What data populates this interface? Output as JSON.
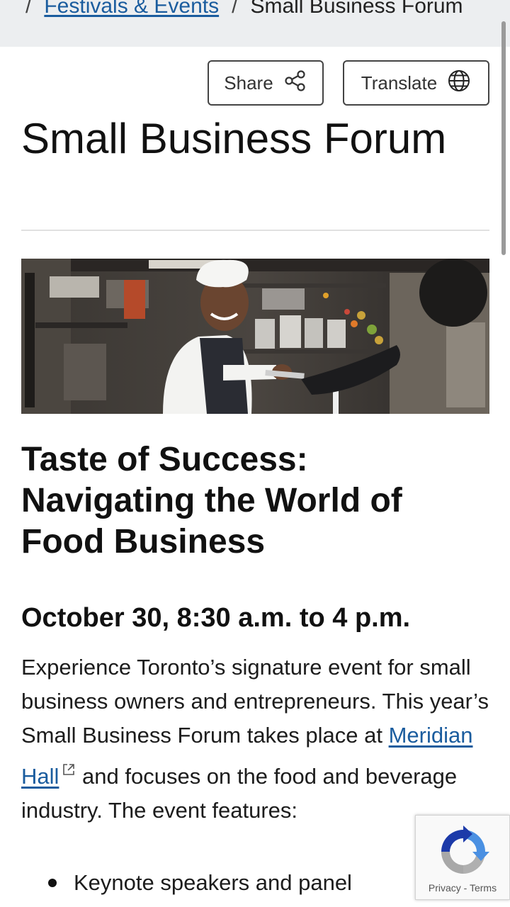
{
  "breadcrumb": {
    "sep1": "/",
    "parent": "Festivals & Events",
    "sep2": "/",
    "current": "Small Business Forum"
  },
  "actions": {
    "share_label": "Share",
    "translate_label": "Translate"
  },
  "page": {
    "title": "Small Business Forum",
    "subtitle": "Taste of Success: Navigating the World of Food Business",
    "date": "October 30, 8:30 a.m. to 4 p.m."
  },
  "body": {
    "text_before_link": "Experience Toronto’s signature event for small business owners and entrepreneurs. This year’s Small Business Forum takes place at ",
    "link_text": "Meridian Hall",
    "text_after_link": " and focuses on the food and beverage industry. The event features:"
  },
  "features": [
    "Keynote speakers and panel"
  ],
  "recaptcha": {
    "privacy": "Privacy",
    "dash": " - ",
    "terms": "Terms"
  },
  "colors": {
    "link": "#1a5c9e",
    "breadcrumb_bg": "#eceef0"
  }
}
